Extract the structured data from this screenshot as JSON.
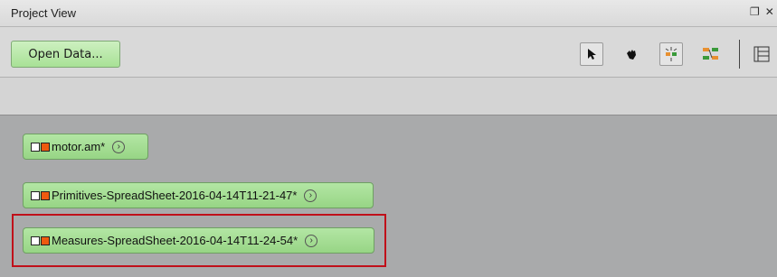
{
  "panel": {
    "title": "Project View",
    "window_icons": [
      "restore-icon",
      "close-icon"
    ]
  },
  "toolbar": {
    "open_data_label": "Open Data...",
    "tools": [
      "pointer-tool-icon",
      "hand-tool-icon",
      "auto-connect-icon",
      "tree-view-icon",
      "layout-icon"
    ]
  },
  "nodes": [
    {
      "label": "motor.am*"
    },
    {
      "label": "Primitives-SpreadSheet-2016-04-14T11-21-47*"
    },
    {
      "label": "Measures-SpreadSheet-2016-04-14T11-24-54*"
    }
  ],
  "colors": {
    "node_fill": "#a6dd95",
    "node_orange": "#ee5a10",
    "highlight": "#c0101a"
  }
}
